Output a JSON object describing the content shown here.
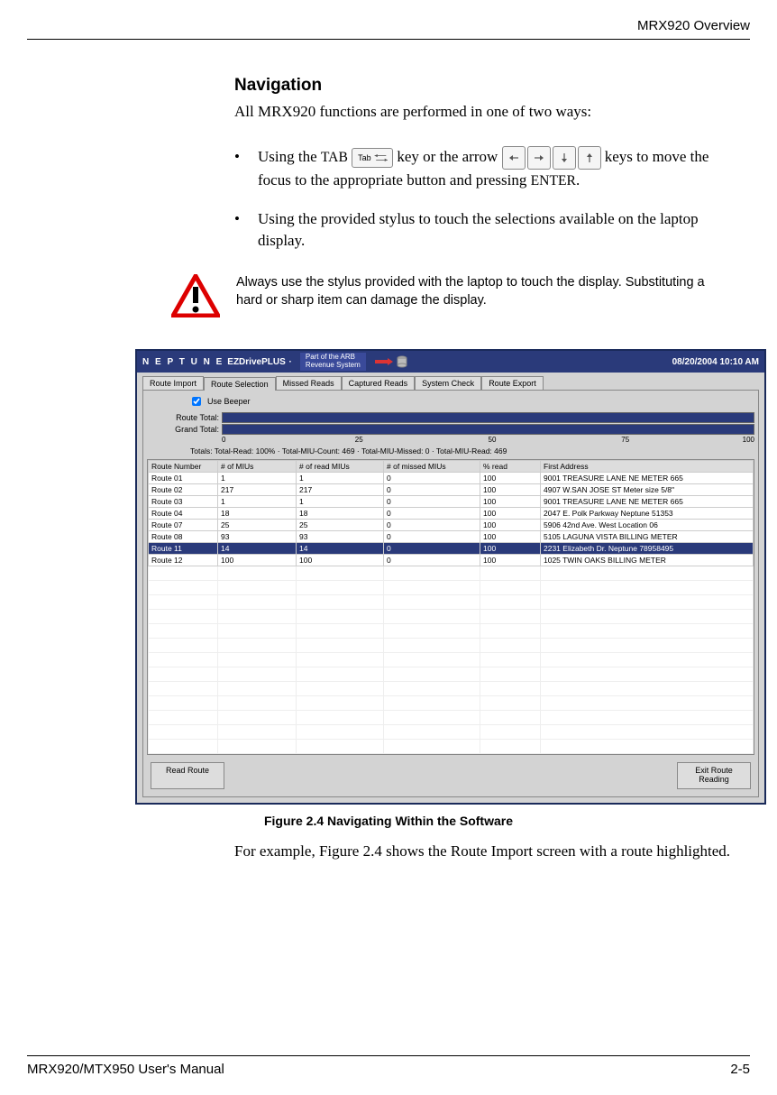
{
  "header": {
    "title": "MRX920 Overview"
  },
  "section": {
    "title": "Navigation",
    "intro": "All MRX920 functions are performed in one of two ways:",
    "bullet1_a": "Using the ",
    "bullet1_tab": "TAB",
    "bullet1_b": " key or the arrow ",
    "bullet1_c": " keys to move the focus to the appropriate button and pressing ",
    "bullet1_enter": "ENTER",
    "bullet1_d": ".",
    "bullet2": "Using the provided stylus to touch the selections available on the laptop display.",
    "tab_key_label": "Tab"
  },
  "warning": "Always use the stylus provided with the laptop to touch the display. Substituting a hard or sharp item can damage the display.",
  "app": {
    "brand": "N E P T U N E",
    "product": "EZDrivePLUS",
    "subtitle_l1": "Part of the ARB",
    "subtitle_l2": "Revenue System",
    "datetime": "08/20/2004 10:10 AM",
    "tabs": [
      "Route Import",
      "Route Selection",
      "Missed Reads",
      "Captured Reads",
      "System Check",
      "Route Export"
    ],
    "beeper_label": "Use Beeper",
    "route_total_label": "Route Total:",
    "grand_total_label": "Grand Total:",
    "scale": [
      "0",
      "25",
      "50",
      "75",
      "100"
    ],
    "totals_prefix": "Totals:",
    "totals_line": "Total-Read: 100%  ·  Total-MIU-Count: 469  ·  Total-MIU-Missed: 0  ·  Total-MIU-Read: 469",
    "columns": [
      "Route Number",
      "# of MIUs",
      "# of read MIUs",
      "# of missed MIUs",
      "% read",
      "First Address"
    ],
    "rows": [
      {
        "r": "Route 01",
        "m": "1",
        "rd": "1",
        "ms": "0",
        "p": "100",
        "a": "9001 TREASURE LANE NE   METER 665"
      },
      {
        "r": "Route 02",
        "m": "217",
        "rd": "217",
        "ms": "0",
        "p": "100",
        "a": "4907 W.SAN JOSE ST      Meter size  5/8\""
      },
      {
        "r": "Route 03",
        "m": "1",
        "rd": "1",
        "ms": "0",
        "p": "100",
        "a": "9001 TREASURE LANE NE   METER 665"
      },
      {
        "r": "Route 04",
        "m": "18",
        "rd": "18",
        "ms": "0",
        "p": "100",
        "a": "2047 E. Polk Parkway       Neptune 51353"
      },
      {
        "r": "Route 07",
        "m": "25",
        "rd": "25",
        "ms": "0",
        "p": "100",
        "a": "5906 42nd Ave. West       Location 06"
      },
      {
        "r": "Route 08",
        "m": "93",
        "rd": "93",
        "ms": "0",
        "p": "100",
        "a": "5105 LAGUNA VISTA       BILLING METER"
      },
      {
        "r": "Route 11",
        "m": "14",
        "rd": "14",
        "ms": "0",
        "p": "100",
        "a": "2231 Elizabeth Dr.           Neptune 78958495",
        "sel": true
      },
      {
        "r": "Route 12",
        "m": "100",
        "rd": "100",
        "ms": "0",
        "p": "100",
        "a": "1025 TWIN OAKS           BILLING METER"
      }
    ],
    "btn_read": "Read Route",
    "btn_exit_l1": "Exit Route",
    "btn_exit_l2": "Reading"
  },
  "figure": {
    "caption": "Figure 2.4   Navigating Within the Software",
    "closing": "For example, Figure 2.4 shows the Route Import screen with a route highlighted."
  },
  "footer": {
    "left": "MRX920/MTX950 User's Manual",
    "right": "2-5"
  }
}
